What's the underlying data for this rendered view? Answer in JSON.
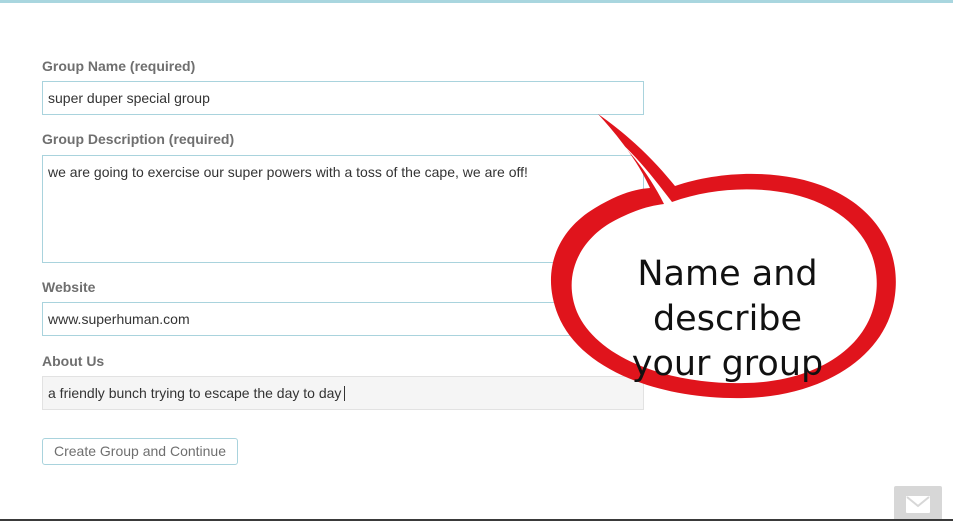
{
  "form": {
    "group_name": {
      "label": "Group Name (required)",
      "value": "super duper special group"
    },
    "group_description": {
      "label": "Group Description (required)",
      "value": "we are going to exercise our super powers with a toss of the cape, we are off!"
    },
    "website": {
      "label": "Website",
      "value": "www.superhuman.com"
    },
    "about_us": {
      "label": "About Us",
      "value": "a friendly bunch trying to escape the day to day"
    },
    "submit_label": "Create Group and Continue"
  },
  "callout": {
    "line1": "Name and describe",
    "line2": "your group"
  },
  "icons": {
    "contact": "envelope-icon"
  },
  "colors": {
    "border_accent": "#a9d3dd",
    "bubble_red": "#e0141c",
    "label_gray": "#6f6f6f"
  }
}
